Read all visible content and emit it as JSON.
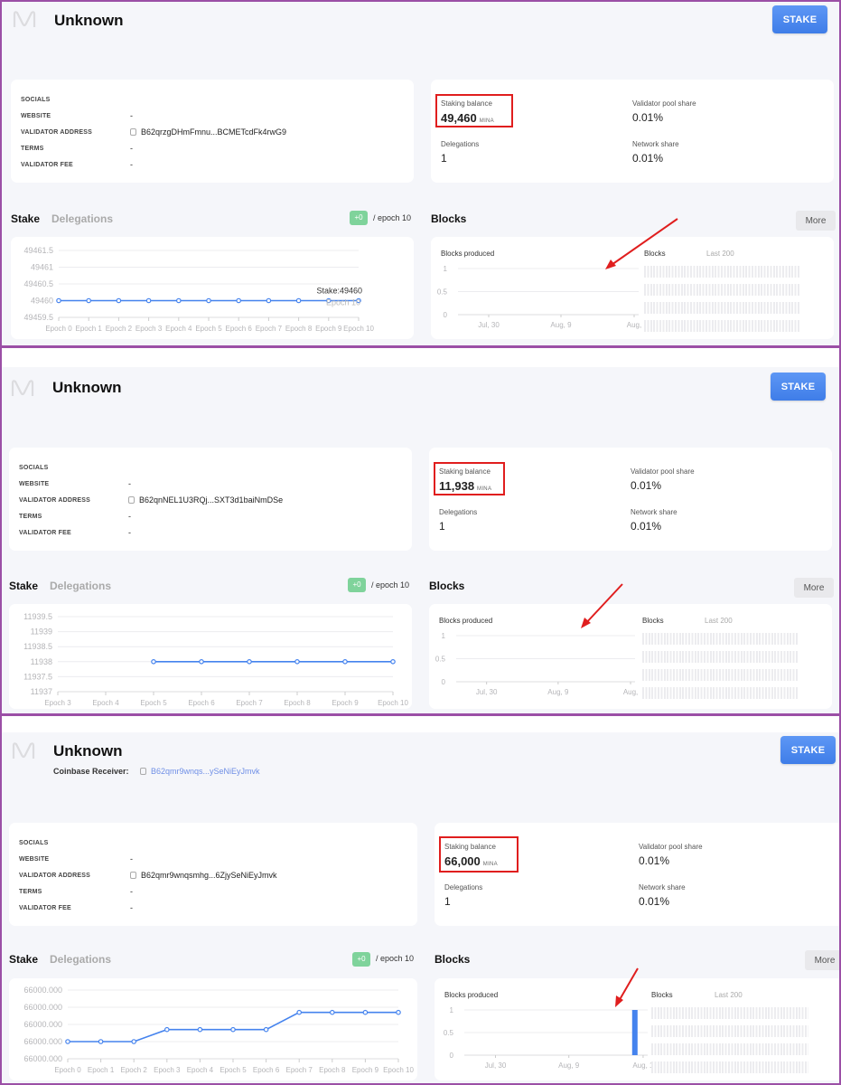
{
  "panels": [
    {
      "header": {
        "title": "Unknown",
        "stake_button": "STAKE"
      },
      "info": {
        "rows": [
          {
            "label": "SOCIALS",
            "value": ""
          },
          {
            "label": "WEBSITE",
            "value": "-"
          },
          {
            "label": "VALIDATOR ADDRESS",
            "value": "B62qrzgDHmFmnu...BCMETcdFk4rwG9"
          },
          {
            "label": "TERMS",
            "value": "-"
          },
          {
            "label": "VALIDATOR FEE",
            "value": "-"
          }
        ]
      },
      "stats": {
        "staking_balance_label": "Staking balance",
        "staking_balance_value": "49,460",
        "staking_balance_unit": "MINA",
        "validator_pool_share_label": "Validator pool share",
        "validator_pool_share_value": "0.01%",
        "delegations_label": "Delegations",
        "delegations_value": "1",
        "network_share_label": "Network share",
        "network_share_value": "0.01%"
      },
      "stake_section": {
        "tab_stake": "Stake",
        "tab_delegations": "Delegations",
        "badge": "+0",
        "epoch_label": "/ epoch 10"
      },
      "blocks_section": {
        "title": "Blocks",
        "more_button": "More",
        "chart_title": "Blocks produced",
        "grid_title": "Blocks",
        "grid_range": "Last 200"
      }
    },
    {
      "header": {
        "title": "Unknown",
        "stake_button": "STAKE"
      },
      "info": {
        "rows": [
          {
            "label": "SOCIALS",
            "value": ""
          },
          {
            "label": "WEBSITE",
            "value": "-"
          },
          {
            "label": "VALIDATOR ADDRESS",
            "value": "B62qnNEL1U3RQj...SXT3d1baiNmDSe"
          },
          {
            "label": "TERMS",
            "value": "-"
          },
          {
            "label": "VALIDATOR FEE",
            "value": "-"
          }
        ]
      },
      "stats": {
        "staking_balance_label": "Staking balance",
        "staking_balance_value": "11,938",
        "staking_balance_unit": "MINA",
        "validator_pool_share_label": "Validator pool share",
        "validator_pool_share_value": "0.01%",
        "delegations_label": "Delegations",
        "delegations_value": "1",
        "network_share_label": "Network share",
        "network_share_value": "0.01%"
      },
      "stake_section": {
        "tab_stake": "Stake",
        "tab_delegations": "Delegations",
        "badge": "+0",
        "epoch_label": "/ epoch 10"
      },
      "blocks_section": {
        "title": "Blocks",
        "more_button": "More",
        "chart_title": "Blocks produced",
        "grid_title": "Blocks",
        "grid_range": "Last 200"
      }
    },
    {
      "header": {
        "title": "Unknown",
        "stake_button": "STAKE",
        "coinbase_label": "Coinbase Receiver:",
        "coinbase_value": "B62qmr9wnqs...ySeNiEyJmvk"
      },
      "info": {
        "rows": [
          {
            "label": "SOCIALS",
            "value": ""
          },
          {
            "label": "WEBSITE",
            "value": "-"
          },
          {
            "label": "VALIDATOR ADDRESS",
            "value": "B62qmr9wnqsmhg...6ZjySeNiEyJmvk"
          },
          {
            "label": "TERMS",
            "value": "-"
          },
          {
            "label": "VALIDATOR FEE",
            "value": "-"
          }
        ]
      },
      "stats": {
        "staking_balance_label": "Staking balance",
        "staking_balance_value": "66,000",
        "staking_balance_unit": "MINA",
        "validator_pool_share_label": "Validator pool share",
        "validator_pool_share_value": "0.01%",
        "delegations_label": "Delegations",
        "delegations_value": "1",
        "network_share_label": "Network share",
        "network_share_value": "0.01%"
      },
      "stake_section": {
        "tab_stake": "Stake",
        "tab_delegations": "Delegations",
        "badge": "+0",
        "epoch_label": "/ epoch 10"
      },
      "blocks_section": {
        "title": "Blocks",
        "more_button": "More",
        "chart_title": "Blocks produced",
        "grid_title": "Blocks",
        "grid_range": "Last 200"
      }
    }
  ],
  "colors": {
    "accent": "#4583ee",
    "badge": "#7fd39b",
    "highlight": "#e01e1e",
    "panel_border": "#9b4fa6",
    "coinbase_link": "#6f8fe6"
  },
  "chart_data": [
    {
      "type": "line",
      "title": "Stake",
      "categories": [
        "Epoch 0",
        "Epoch 1",
        "Epoch 2",
        "Epoch 3",
        "Epoch 4",
        "Epoch 5",
        "Epoch 6",
        "Epoch 7",
        "Epoch 8",
        "Epoch 9",
        "Epoch 10"
      ],
      "series": [
        {
          "name": "Stake",
          "values": [
            49460,
            49460,
            49460,
            49460,
            49460,
            49460,
            49460,
            49460,
            49460,
            49460,
            49460
          ]
        }
      ],
      "yticks": [
        "49459.5",
        "49460",
        "49460.5",
        "49461",
        "49461.5"
      ],
      "ylim": [
        49459.5,
        49461.5
      ],
      "tooltip": {
        "line1": "Stake:49460",
        "line2": "Epoch 10"
      },
      "grid": true
    },
    {
      "type": "line",
      "title": "Stake",
      "categories": [
        "Epoch 3",
        "Epoch 4",
        "Epoch 5",
        "Epoch 6",
        "Epoch 7",
        "Epoch 8",
        "Epoch 9",
        "Epoch 10"
      ],
      "series": [
        {
          "name": "Stake",
          "values": [
            null,
            null,
            11938,
            11938,
            11938,
            11938,
            11938,
            11938
          ]
        }
      ],
      "yticks": [
        "11937",
        "11937.5",
        "11938",
        "11938.5",
        "11939",
        "11939.5"
      ],
      "ylim": [
        11937,
        11939.5
      ],
      "grid": true
    },
    {
      "type": "line",
      "title": "Stake",
      "categories": [
        "Epoch 0",
        "Epoch 1",
        "Epoch 2",
        "Epoch 3",
        "Epoch 4",
        "Epoch 5",
        "Epoch 6",
        "Epoch 7",
        "Epoch 8",
        "Epoch 9",
        "Epoch 10"
      ],
      "series": [
        {
          "name": "Stake",
          "values": [
            1,
            1,
            1,
            1.7,
            1.7,
            1.7,
            1.7,
            2.7,
            2.7,
            2.7,
            2.7
          ]
        }
      ],
      "yticks": [
        "66000.000",
        "66000.000",
        "66000.000",
        "66000.000",
        "66000.000"
      ],
      "ylim": [
        0,
        4
      ],
      "ylabel_note": "relative scale; all tick labels read 66000.000",
      "grid": true
    },
    {
      "type": "bar",
      "title": "Blocks produced",
      "categories": [
        "Jul, 30",
        "Aug, 9",
        "Aug,"
      ],
      "series": [
        {
          "name": "Blocks produced",
          "values": []
        }
      ],
      "yticks": [
        "0",
        "0.5",
        "1"
      ],
      "ylim": [
        0,
        1
      ],
      "grid": true
    },
    {
      "type": "bar",
      "title": "Blocks produced",
      "categories": [
        "Jul, 30",
        "Aug, 9",
        "Aug,"
      ],
      "series": [
        {
          "name": "Blocks produced",
          "values": []
        }
      ],
      "yticks": [
        "0",
        "0.5",
        "1"
      ],
      "ylim": [
        0,
        1
      ],
      "grid": true
    },
    {
      "type": "bar",
      "title": "Blocks produced",
      "categories": [
        "Jul, 30",
        "Aug, 9",
        "Aug, 1"
      ],
      "series": [
        {
          "name": "Blocks produced",
          "values": [
            {
              "x_fraction_of_range": 0.93,
              "value": 1
            }
          ]
        }
      ],
      "yticks": [
        "0",
        "0.5",
        "1"
      ],
      "ylim": [
        0,
        1
      ],
      "grid": true
    }
  ]
}
